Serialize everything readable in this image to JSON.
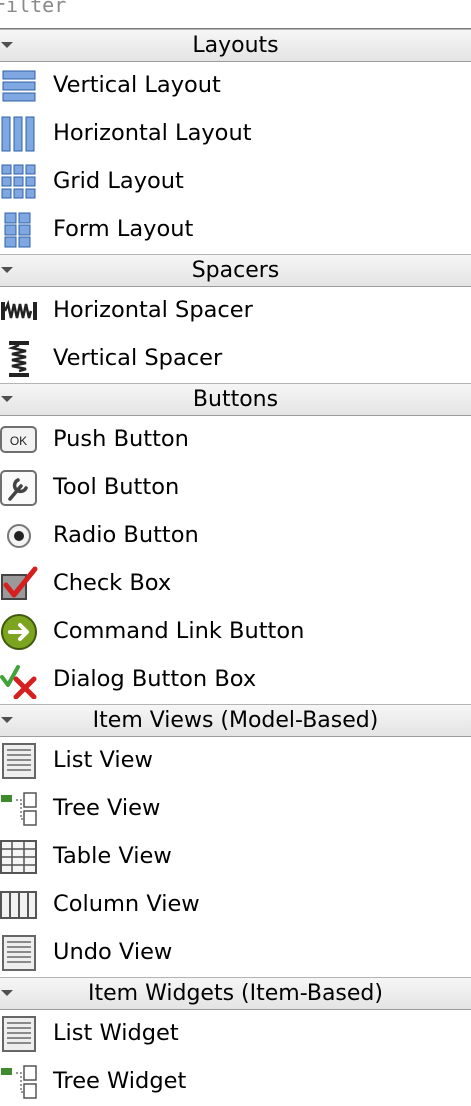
{
  "filter": {
    "placeholder": "Filter"
  },
  "categories": [
    {
      "title": "Layouts",
      "items": [
        {
          "label": "Vertical Layout",
          "icon": "vertical-layout-icon"
        },
        {
          "label": "Horizontal Layout",
          "icon": "horizontal-layout-icon"
        },
        {
          "label": "Grid Layout",
          "icon": "grid-layout-icon"
        },
        {
          "label": "Form Layout",
          "icon": "form-layout-icon"
        }
      ]
    },
    {
      "title": "Spacers",
      "items": [
        {
          "label": "Horizontal Spacer",
          "icon": "horizontal-spacer-icon"
        },
        {
          "label": "Vertical Spacer",
          "icon": "vertical-spacer-icon"
        }
      ]
    },
    {
      "title": "Buttons",
      "items": [
        {
          "label": "Push Button",
          "icon": "push-button-icon",
          "icon_text": "OK"
        },
        {
          "label": "Tool Button",
          "icon": "tool-button-icon"
        },
        {
          "label": "Radio Button",
          "icon": "radio-button-icon"
        },
        {
          "label": "Check Box",
          "icon": "check-box-icon"
        },
        {
          "label": "Command Link Button",
          "icon": "command-link-icon"
        },
        {
          "label": "Dialog Button Box",
          "icon": "dialog-button-box-icon"
        }
      ]
    },
    {
      "title": "Item Views (Model-Based)",
      "items": [
        {
          "label": "List View",
          "icon": "list-view-icon"
        },
        {
          "label": "Tree View",
          "icon": "tree-view-icon"
        },
        {
          "label": "Table View",
          "icon": "table-view-icon"
        },
        {
          "label": "Column View",
          "icon": "column-view-icon"
        },
        {
          "label": "Undo View",
          "icon": "undo-view-icon"
        }
      ]
    },
    {
      "title": "Item Widgets (Item-Based)",
      "items": [
        {
          "label": "List Widget",
          "icon": "list-widget-icon"
        },
        {
          "label": "Tree Widget",
          "icon": "tree-widget-icon"
        }
      ]
    }
  ]
}
